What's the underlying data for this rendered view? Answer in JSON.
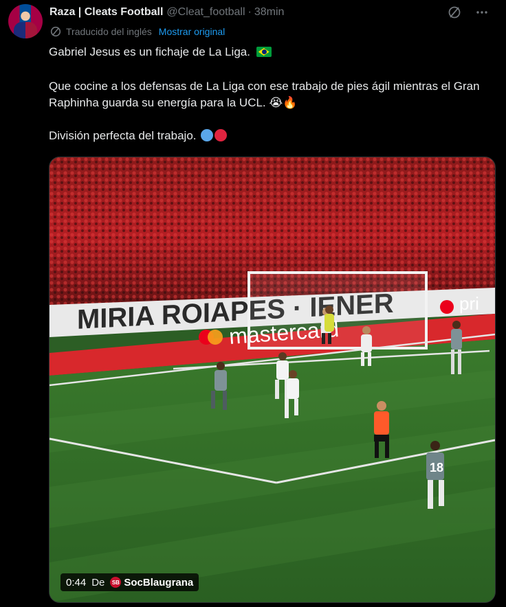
{
  "author": {
    "name": "Raza | Cleats Football",
    "handle": "@Cleat_football",
    "separator": "·",
    "time": "38min"
  },
  "translation": {
    "label": "Traducido del inglés",
    "show_original": "Mostrar original"
  },
  "tweet": {
    "line1": "Gabriel Jesus es un fichaje de La Liga.",
    "line2": "Que cocine a los defensas de La Liga con ese trabajo de pies ágil mientras el Gran Raphinha guarda su energía para la UCL.",
    "line3": "División perfecta del trabajo."
  },
  "emojis": {
    "flag": "brazil-flag",
    "line2": [
      "crying-face",
      "fire"
    ],
    "circles": [
      "#5aa7ea",
      "#e0243f"
    ]
  },
  "video": {
    "duration": "0:44",
    "from_label": "De",
    "source": "SocBlaugrana",
    "ad_board": "mastercard",
    "ad_board_right": "pri"
  },
  "icons": {
    "grok": "slash-circle-icon",
    "more": "more-icon"
  }
}
